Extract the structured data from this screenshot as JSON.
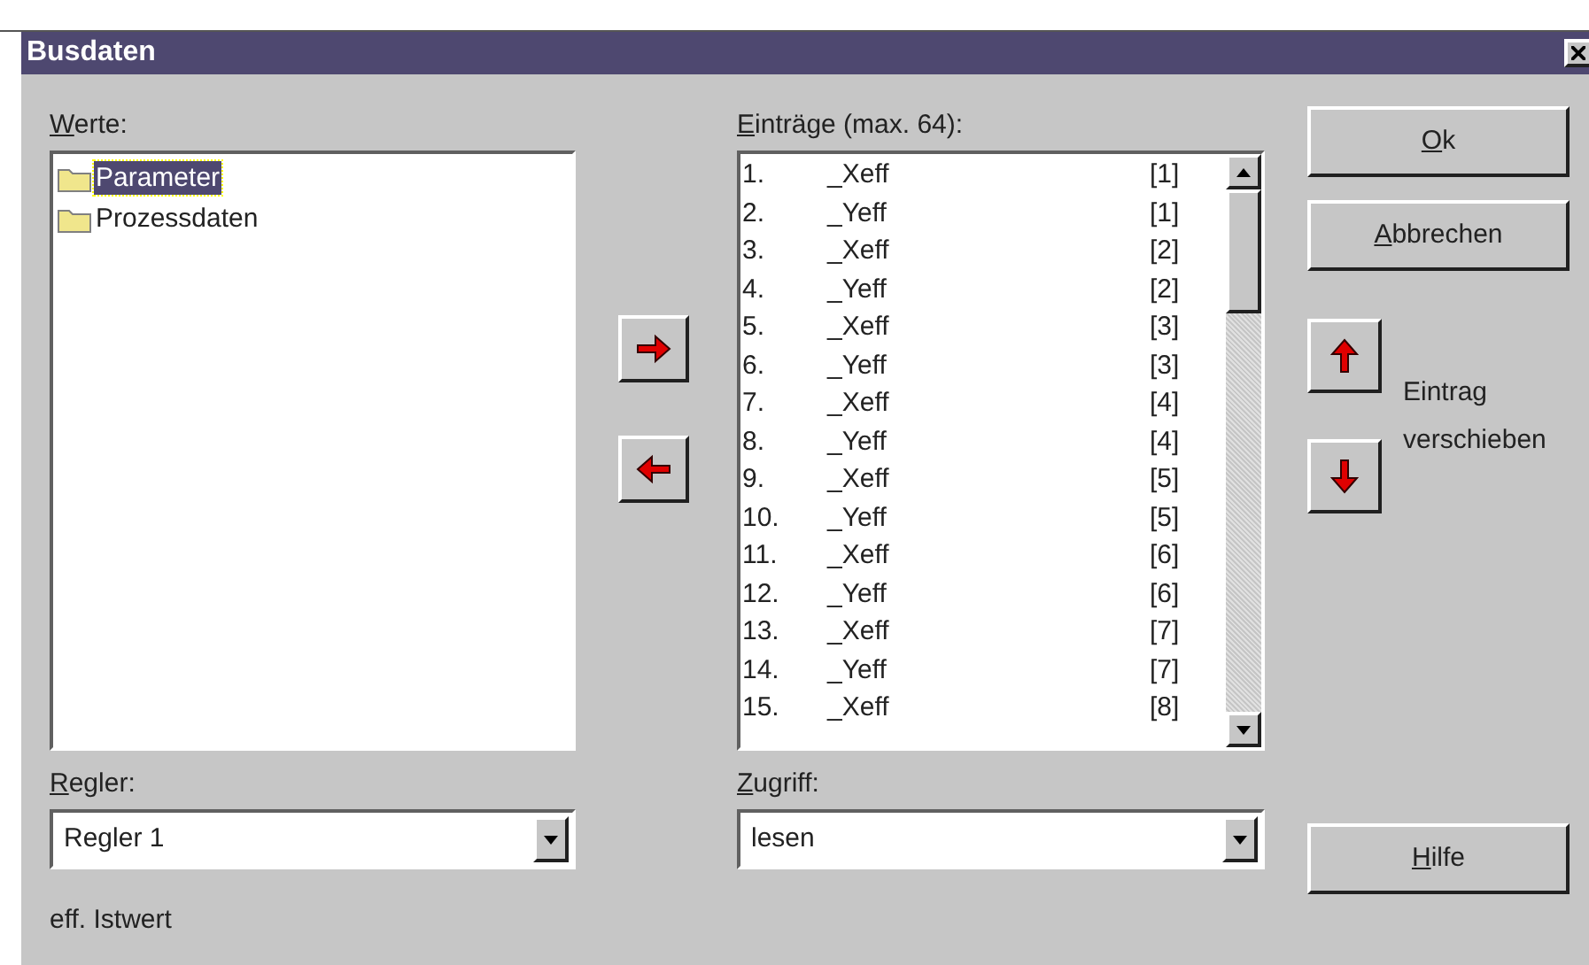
{
  "window": {
    "title": "Busdaten"
  },
  "values_panel": {
    "label": "Werte:",
    "items": [
      {
        "label": "Parameter",
        "selected": true
      },
      {
        "label": "Prozessdaten",
        "selected": false
      }
    ]
  },
  "entries_panel": {
    "label": "Einträge (max. 64):",
    "entries": [
      {
        "number": "1.",
        "name": "_Xeff",
        "index": "[1]"
      },
      {
        "number": "2.",
        "name": "_Yeff",
        "index": "[1]"
      },
      {
        "number": "3.",
        "name": "_Xeff",
        "index": "[2]"
      },
      {
        "number": "4.",
        "name": "_Yeff",
        "index": "[2]"
      },
      {
        "number": "5.",
        "name": "_Xeff",
        "index": "[3]"
      },
      {
        "number": "6.",
        "name": "_Yeff",
        "index": "[3]"
      },
      {
        "number": "7.",
        "name": "_Xeff",
        "index": "[4]"
      },
      {
        "number": "8.",
        "name": "_Yeff",
        "index": "[4]"
      },
      {
        "number": "9.",
        "name": "_Xeff",
        "index": "[5]"
      },
      {
        "number": "10.",
        "name": "_Yeff",
        "index": "[5]"
      },
      {
        "number": "11.",
        "name": "_Xeff",
        "index": "[6]"
      },
      {
        "number": "12.",
        "name": "_Yeff",
        "index": "[6]"
      },
      {
        "number": "13.",
        "name": "_Xeff",
        "index": "[7]"
      },
      {
        "number": "14.",
        "name": "_Yeff",
        "index": "[7]"
      },
      {
        "number": "15.",
        "name": "_Xeff",
        "index": "[8]"
      }
    ]
  },
  "controller": {
    "label": "Regler:",
    "value": "Regler 1"
  },
  "access": {
    "label": "Zugriff:",
    "value": "lesen"
  },
  "buttons": {
    "ok": "Ok",
    "cancel": "Abbrechen",
    "help": "Hilfe"
  },
  "move_label": "Eintrag verschieben",
  "status_text": "eff. Istwert"
}
